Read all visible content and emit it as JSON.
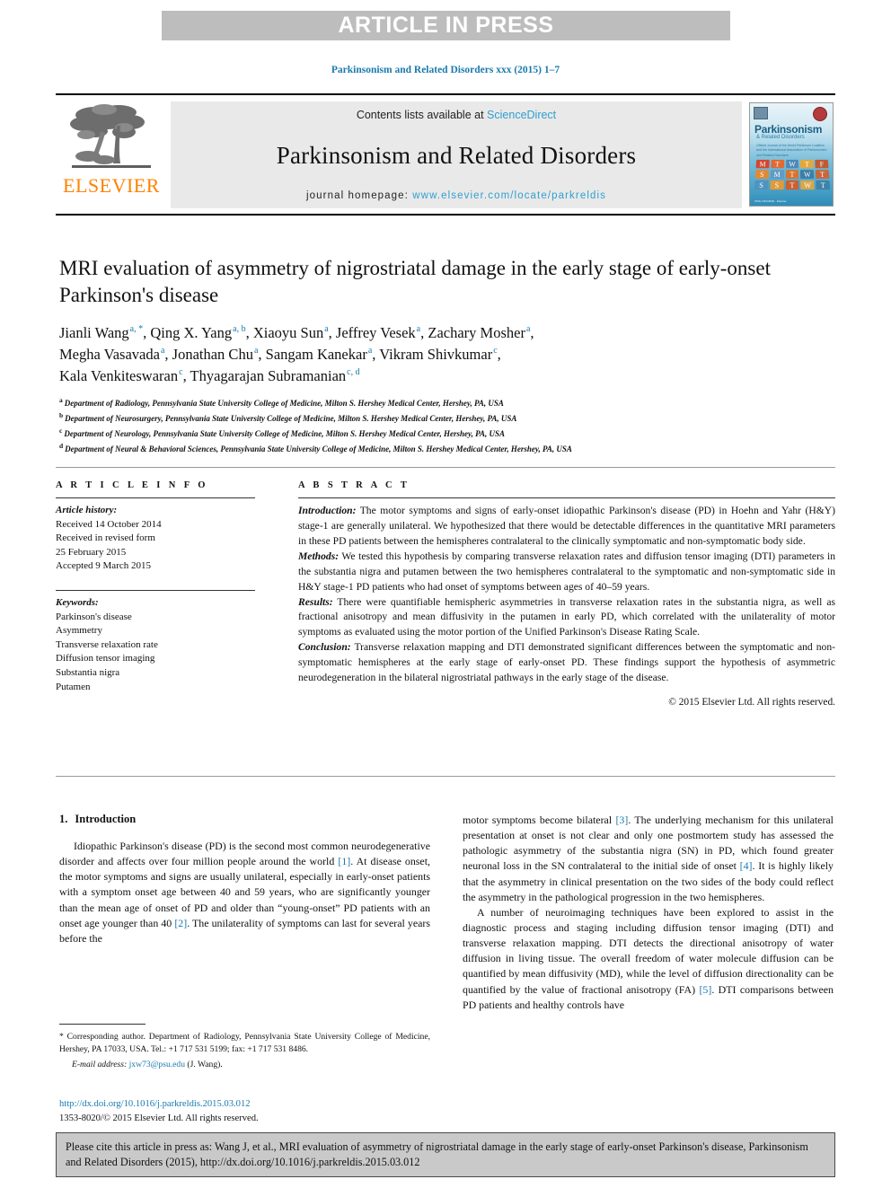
{
  "banner": {
    "text": "ARTICLE IN PRESS"
  },
  "running_head": "Parkinsonism and Related Disorders xxx (2015) 1–7",
  "masthead": {
    "contents_prefix": "Contents lists available at",
    "sciencedirect": "ScienceDirect",
    "journal_title": "Parkinsonism and Related Disorders",
    "homepage_prefix": "journal homepage:",
    "homepage_url": "www.elsevier.com/locate/parkreldis",
    "publisher": "ELSEVIER",
    "cover": {
      "title": "Parkinsonism",
      "subtitle": "& Related Disorders",
      "blurb": "Official Journal of the World Parkinson Coalition and the International Association of Parkinsonism and Related Disorders",
      "grid": [
        "M",
        "T",
        "W",
        "T",
        "F",
        "S",
        "M",
        "T",
        "W",
        "T",
        "S",
        "S",
        "T",
        "W",
        "T"
      ],
      "footer": "ISSN 1353-8020 · Elsevier"
    },
    "link_color": "#2f9fd0"
  },
  "title": "MRI evaluation of asymmetry of nigrostriatal damage in the early stage of early-onset Parkinson's disease",
  "authors": [
    {
      "name": "Jianli Wang",
      "sup": "a, *"
    },
    {
      "name": "Qing X. Yang",
      "sup": "a, b"
    },
    {
      "name": "Xiaoyu Sun",
      "sup": "a"
    },
    {
      "name": "Jeffrey Vesek",
      "sup": "a"
    },
    {
      "name": "Zachary Mosher",
      "sup": "a"
    },
    {
      "name": "Megha Vasavada",
      "sup": "a"
    },
    {
      "name": "Jonathan Chu",
      "sup": "a"
    },
    {
      "name": "Sangam Kanekar",
      "sup": "a"
    },
    {
      "name": "Vikram Shivkumar",
      "sup": "c"
    },
    {
      "name": "Kala Venkiteswaran",
      "sup": "c"
    },
    {
      "name": "Thyagarajan Subramanian",
      "sup": "c, d"
    }
  ],
  "affiliations": [
    {
      "mark": "a",
      "text": "Department of Radiology, Pennsylvania State University College of Medicine, Milton S. Hershey Medical Center, Hershey, PA, USA"
    },
    {
      "mark": "b",
      "text": "Department of Neurosurgery, Pennsylvania State University College of Medicine, Milton S. Hershey Medical Center, Hershey, PA, USA"
    },
    {
      "mark": "c",
      "text": "Department of Neurology, Pennsylvania State University College of Medicine, Milton S. Hershey Medical Center, Hershey, PA, USA"
    },
    {
      "mark": "d",
      "text": "Department of Neural & Behavioral Sciences, Pennsylvania State University College of Medicine, Milton S. Hershey Medical Center, Hershey, PA, USA"
    }
  ],
  "article_info": {
    "heading": "A R T I C L E  I N F O",
    "history_label": "Article history:",
    "history_lines": [
      "Received 14 October 2014",
      "Received in revised form",
      "25 February 2015",
      "Accepted 9 March 2015"
    ],
    "keywords_label": "Keywords:",
    "keywords": [
      "Parkinson's disease",
      "Asymmetry",
      "Transverse relaxation rate",
      "Diffusion tensor imaging",
      "Substantia nigra",
      "Putamen"
    ]
  },
  "abstract": {
    "heading": "A B S T R A C T",
    "sections": [
      {
        "lead": "Introduction:",
        "text": " The motor symptoms and signs of early-onset idiopathic Parkinson's disease (PD) in Hoehn and Yahr (H&Y) stage-1 are generally unilateral. We hypothesized that there would be detectable differences in the quantitative MRI parameters in these PD patients between the hemispheres contralateral to the clinically symptomatic and non-symptomatic body side."
      },
      {
        "lead": "Methods:",
        "text": " We tested this hypothesis by comparing transverse relaxation rates and diffusion tensor imaging (DTI) parameters in the substantia nigra and putamen between the two hemispheres contralateral to the symptomatic and non-symptomatic side in H&Y stage-1 PD patients who had onset of symptoms between ages of 40–59 years."
      },
      {
        "lead": "Results:",
        "text": " There were quantifiable hemispheric asymmetries in transverse relaxation rates in the substantia nigra, as well as fractional anisotropy and mean diffusivity in the putamen in early PD, which correlated with the unilaterality of motor symptoms as evaluated using the motor portion of the Unified Parkinson's Disease Rating Scale."
      },
      {
        "lead": "Conclusion:",
        "text": " Transverse relaxation mapping and DTI demonstrated significant differences between the symptomatic and non-symptomatic hemispheres at the early stage of early-onset PD. These findings support the hypothesis of asymmetric neurodegeneration in the bilateral nigrostriatal pathways in the early stage of the disease."
      }
    ],
    "copyright": "© 2015 Elsevier Ltd. All rights reserved."
  },
  "body": {
    "section_number": "1.",
    "section_title": "Introduction",
    "left_paragraph_1a": "Idiopathic Parkinson's disease (PD) is the second most common neurodegenerative disorder and affects over four million people around the world ",
    "ref1": "[1]",
    "left_paragraph_1b": ". At disease onset, the motor symptoms and signs are usually unilateral, especially in early-onset patients with a symptom onset age between 40 and 59 years, who are significantly younger than the mean age of onset of PD and older than “young-onset” PD patients with an onset age younger than 40 ",
    "ref2": "[2]",
    "left_paragraph_1c": ". The unilaterality of symptoms can last for several years before the",
    "right_paragraph_1a": "motor symptoms become bilateral ",
    "ref3": "[3]",
    "right_paragraph_1b": ". The underlying mechanism for this unilateral presentation at onset is not clear and only one postmortem study has assessed the pathologic asymmetry of the substantia nigra (SN) in PD, which found greater neuronal loss in the SN contralateral to the initial side of onset ",
    "ref4": "[4]",
    "right_paragraph_1c": ". It is highly likely that the asymmetry in clinical presentation on the two sides of the body could reflect the asymmetry in the pathological progression in the two hemispheres.",
    "right_paragraph_2a": "A number of neuroimaging techniques have been explored to assist in the diagnostic process and staging including diffusion tensor imaging (DTI) and transverse relaxation mapping. DTI detects the directional anisotropy of water diffusion in living tissue. The overall freedom of water molecule diffusion can be quantified by mean diffusivity (MD), while the level of diffusion directionality can be quantified by the value of fractional anisotropy (FA) ",
    "ref5": "[5]",
    "right_paragraph_2b": ". DTI comparisons between PD patients and healthy controls have"
  },
  "footnote": {
    "star": "*",
    "corresponding": " Corresponding author. Department of Radiology, Pennsylvania State University College of Medicine, Hershey, PA 17033, USA. Tel.: +1 717 531 5199; fax: +1 717 531 8486.",
    "email_label": "E-mail address:",
    "email": "jxw73@psu.edu",
    "email_owner": "(J. Wang)."
  },
  "doi_block": {
    "doi_url": "http://dx.doi.org/10.1016/j.parkreldis.2015.03.012",
    "issn_line": "1353-8020/© 2015 Elsevier Ltd. All rights reserved."
  },
  "cite_box": {
    "text": "Please cite this article in press as: Wang J, et al., MRI evaluation of asymmetry of nigrostriatal damage in the early stage of early-onset Parkinson's disease, Parkinsonism and Related Disorders (2015), http://dx.doi.org/10.1016/j.parkreldis.2015.03.012"
  }
}
